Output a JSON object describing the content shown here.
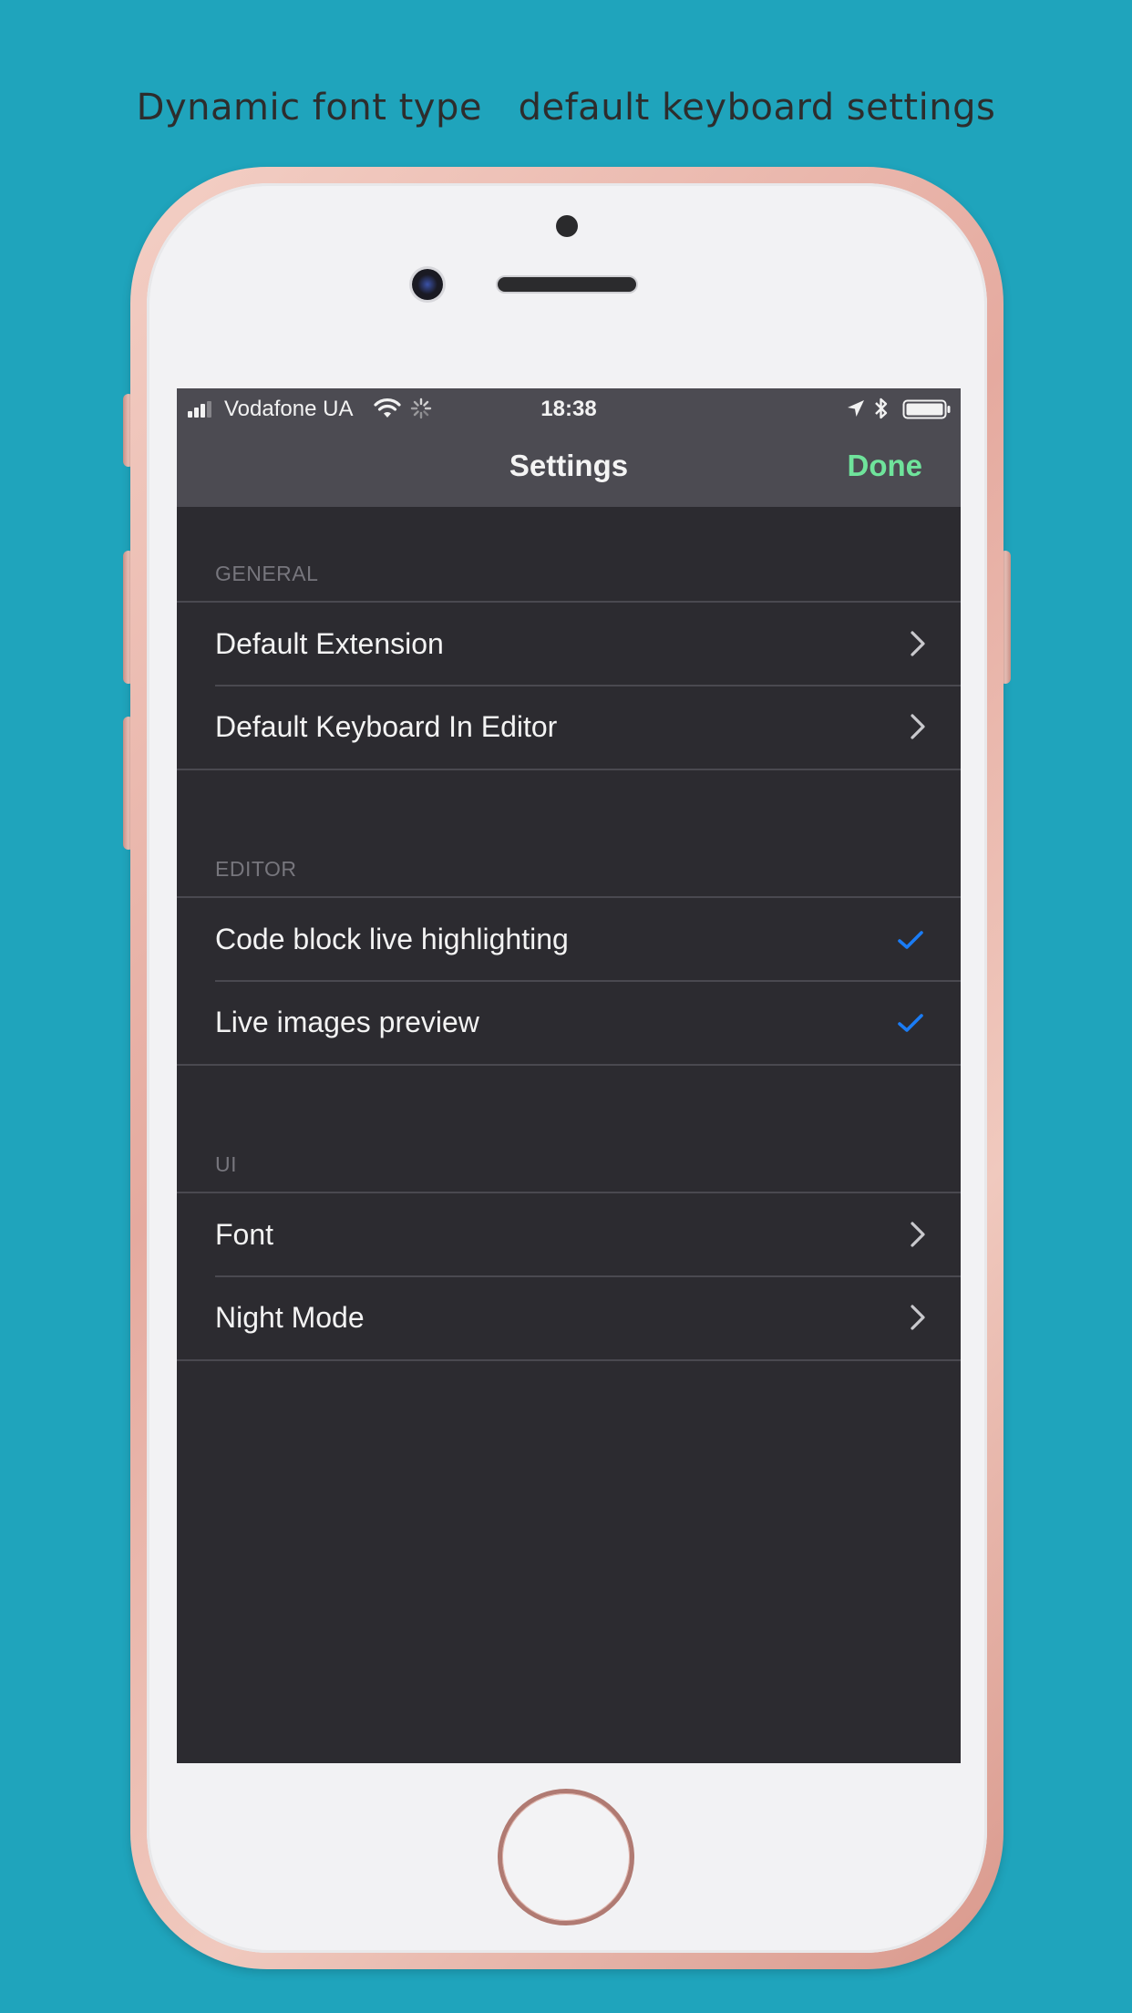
{
  "caption": {
    "text": "Dynamic font type   default keyboard settings"
  },
  "status_bar": {
    "carrier": "Vodafone UA",
    "time": "18:38",
    "icons": [
      "signal-icon",
      "wifi-icon",
      "activity-spinner-icon",
      "location-arrow-icon",
      "bluetooth-icon",
      "battery-icon"
    ]
  },
  "nav": {
    "title": "Settings",
    "done_label": "Done"
  },
  "sections": {
    "general": {
      "header": "GENERAL",
      "items": [
        {
          "label": "Default Extension",
          "accessory": "chevron-right-icon"
        },
        {
          "label": "Default Keyboard In Editor",
          "accessory": "chevron-right-icon"
        }
      ]
    },
    "editor": {
      "header": "EDITOR",
      "items": [
        {
          "label": "Code block live highlighting",
          "accessory": "checkmark-icon",
          "checked": true
        },
        {
          "label": "Live images preview",
          "accessory": "checkmark-icon",
          "checked": true
        }
      ]
    },
    "ui": {
      "header": "UI",
      "items": [
        {
          "label": "Font",
          "accessory": "chevron-right-icon"
        },
        {
          "label": "Night Mode",
          "accessory": "chevron-right-icon"
        }
      ]
    }
  },
  "colors": {
    "background": "#1fa4bc",
    "screen": "#2c2b30",
    "bars": "#4c4b52",
    "done_accent": "#6fe39b",
    "check_accent": "#1a7cf5"
  }
}
